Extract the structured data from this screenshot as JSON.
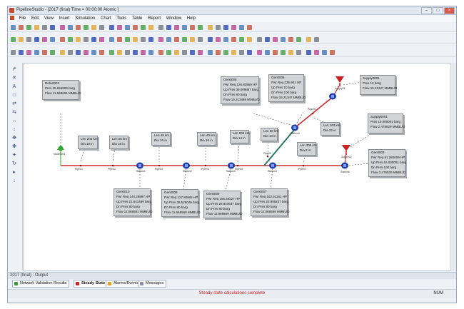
{
  "window": {
    "title": "PipelineStudio - [2017 (final) Time = 00:00:00 Atomic ]"
  },
  "menu": [
    "File",
    "Edit",
    "View",
    "Insert",
    "Simulation",
    "Chart",
    "Tools",
    "Table",
    "Report",
    "Window",
    "Help"
  ],
  "output_bar": {
    "title": "2017 (final) : Output"
  },
  "tabs": [
    {
      "label": "Network Validation Results",
      "active": false
    },
    {
      "label": "Steady State",
      "active": true
    },
    {
      "label": "Alarms/Events",
      "active": false
    },
    {
      "label": "Messages",
      "active": false
    }
  ],
  "status": {
    "message": "Steady state calculations complete",
    "num": "NUM"
  },
  "left_tools": [
    "↱",
    "✕",
    "A",
    "□",
    "⇄",
    "⇆",
    "↔",
    "↕",
    "✥",
    "✤",
    "✦",
    "↻",
    "▸",
    "↓"
  ],
  "network": {
    "pipe_color": "#d02a2a",
    "diagonal_pipe_color": "#2a7a6a",
    "station_color": "#1f3fb0",
    "supply_color": "#cc1f1f",
    "delivery_color": "#2ea52e",
    "node_labels": [
      "Node0001",
      "Pipe01",
      "Pipe02",
      "Station1",
      "Pipe03",
      "Station2",
      "Pipe04",
      "Station3",
      "Pipe05",
      "Station4",
      "Pipe06",
      "Station5",
      "Pipe07",
      "Station6",
      "Pipe08",
      "Supply01",
      "Supply02"
    ],
    "boxes": {
      "deliv": [
        "Deliv0001",
        "Pres 35.656909 barg",
        "Flow 11.568694 MMBL/D"
      ],
      "pipe1": [
        "Len 203 km",
        "Dia 18 in"
      ],
      "pipe2": [
        "Len 55 km",
        "Dia 18 in"
      ],
      "pipe3": [
        "Len 45 km",
        "Dia 16 in"
      ],
      "pipe4": [
        "Len 40 km",
        "Dia 16 in"
      ],
      "pipe5": [
        "Len 205 km",
        "Dia 14 in"
      ],
      "pipe6": [
        "Len 50 km",
        "Dia 10 in"
      ],
      "pipe7": [
        "Len 305 km",
        "Dia 8 in"
      ],
      "pipe8": [
        "Len 162 km",
        "Dia 22 in"
      ],
      "gen1": [
        "Gen0010",
        "Pwr Req 144.28897 HP",
        "Up Pres 21.641469 barg",
        "Dn Pres 80 barg",
        "Flow 11.568581 MMBL/D"
      ],
      "gen2": [
        "Gen0008",
        "Pwr Req 127.80882 HP",
        "Up Pres 35.528049 barg",
        "Dn Pres 80 barg",
        "Flow 11.568569 MMBL/D"
      ],
      "gen3": [
        "Gen0009",
        "Pwr Req 166.46227 HP",
        "Up Pres 26.644637 barg",
        "Dn Pres 80 barg",
        "Flow 11.568569 MMBL/D"
      ],
      "gen4": [
        "Gen0007",
        "Pwr Req 162.51151 HP",
        "Up Pres 22.895227 barg",
        "Dn Pres 80 barg",
        "Flow 11.568589 MMBL/D"
      ],
      "gen5": [
        "Gen0005",
        "Pwr Req 126.83569 HP",
        "Up Pres 35.009857 barg",
        "Dn Pres 80 barg",
        "Flow 15.213489 MMBL/D"
      ],
      "gen6": [
        "Gen0006",
        "Pwr Req 235.901 HP",
        "Up Pres 10 barg",
        "Dn Pres 100 barg",
        "Flow 15.21347 MMBL/D"
      ],
      "supply1": [
        "Supply0001",
        "Pres 10 barg",
        "Flow 15.21347 MMBL/D"
      ],
      "supply2": [
        "Supply0001",
        "Pres 15.000001 barg",
        "Flow 2.476529 MMBL/D"
      ],
      "gen7": [
        "Gen0003",
        "Pwr Req 91.282009 HP",
        "Up Pres 15.000001 barg",
        "Dn Pres 100 barg",
        "Flow 2.476529 MMBL/D"
      ]
    }
  }
}
